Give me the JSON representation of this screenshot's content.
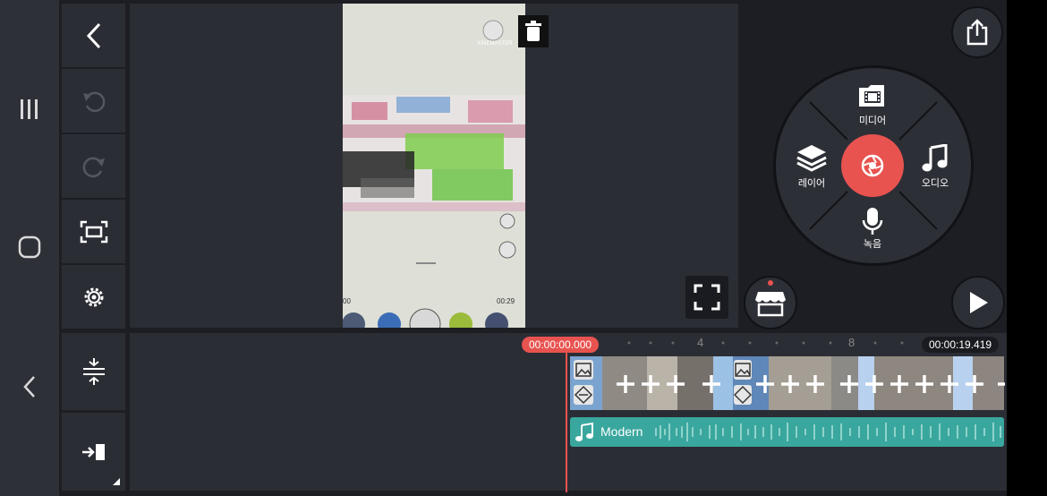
{
  "preview": {
    "watermark": "KINEMASTER",
    "video_time_left": "00",
    "video_time_right": "00:29"
  },
  "menu_wheel": {
    "media_label": "미디어",
    "layer_label": "레이어",
    "audio_label": "오디오",
    "record_label": "녹음"
  },
  "timeline": {
    "current_time": "00:00:00.000",
    "total_time": "00:00:19.419",
    "ruler_marks": [
      "4",
      "8"
    ],
    "audio_clip_name": "Modern"
  },
  "colors": {
    "accent": "#e8534f",
    "audio_track": "#3aa79e",
    "panel": "#2b2d35"
  }
}
